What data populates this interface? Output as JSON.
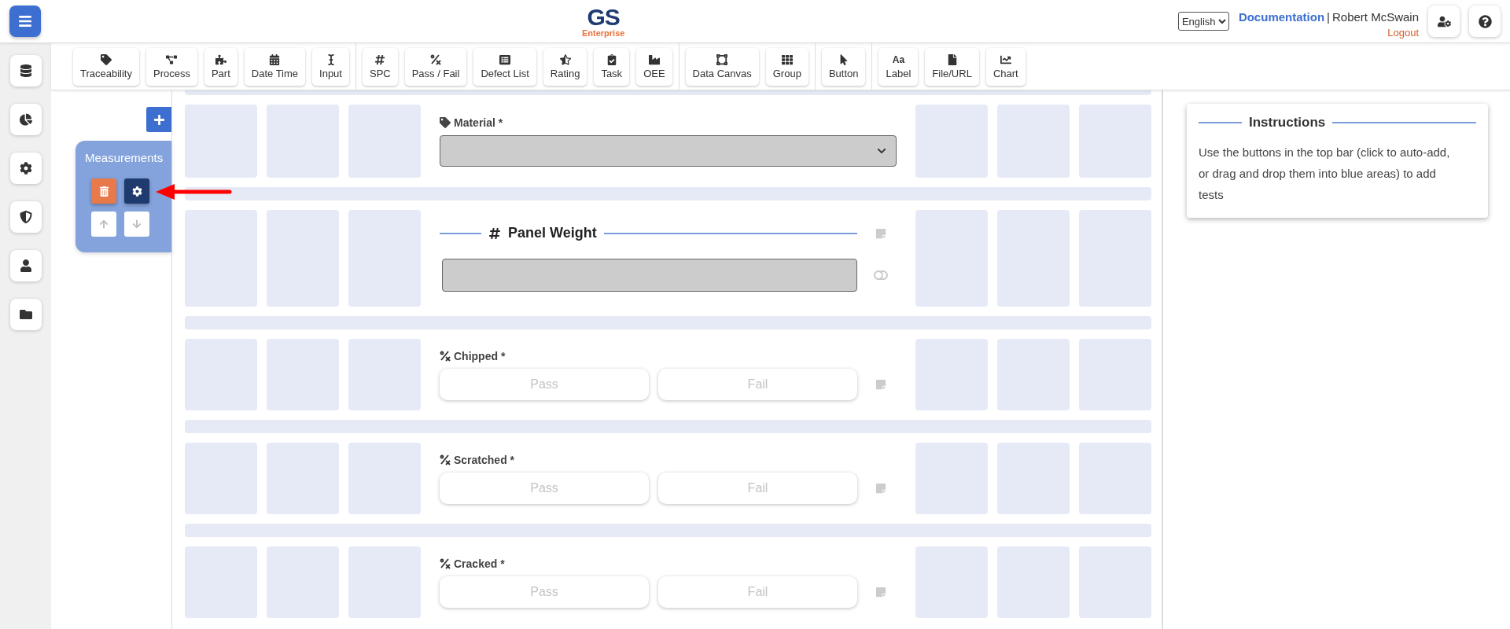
{
  "header": {
    "logo": {
      "title": "GS",
      "subtitle": "Enterprise"
    },
    "language": "English",
    "documentation": "Documentation",
    "divider": "|",
    "user": "Robert McSwain",
    "logout": "Logout"
  },
  "toolbar": {
    "groups": [
      [
        {
          "label": "Traceability"
        },
        {
          "label": "Process"
        },
        {
          "label": "Part"
        },
        {
          "label": "Date Time"
        },
        {
          "label": "Input"
        }
      ],
      [
        {
          "label": "SPC"
        },
        {
          "label": "Pass / Fail"
        },
        {
          "label": "Defect List"
        },
        {
          "label": "Rating"
        },
        {
          "label": "Task"
        },
        {
          "label": "OEE"
        }
      ],
      [
        {
          "label": "Data Canvas"
        },
        {
          "label": "Group"
        }
      ],
      [
        {
          "label": "Button"
        }
      ],
      [
        {
          "label": "Label",
          "glyph": "Aa"
        },
        {
          "label": "File/URL"
        },
        {
          "label": "Chart"
        }
      ]
    ]
  },
  "panel": {
    "group": {
      "title": "Measurements"
    }
  },
  "form": {
    "rows": [
      {
        "kind": "select",
        "label": "Material *"
      },
      {
        "kind": "heading",
        "label": "Panel Weight"
      },
      {
        "kind": "passfail",
        "label": "Chipped *",
        "pass": "Pass",
        "fail": "Fail"
      },
      {
        "kind": "passfail",
        "label": "Scratched *",
        "pass": "Pass",
        "fail": "Fail"
      },
      {
        "kind": "passfail",
        "label": "Cracked *",
        "pass": "Pass",
        "fail": "Fail"
      }
    ]
  },
  "instructions": {
    "title": "Instructions",
    "text": "Use the buttons in the top bar (click to auto-add, or drag and drop them into blue areas) to add tests"
  }
}
